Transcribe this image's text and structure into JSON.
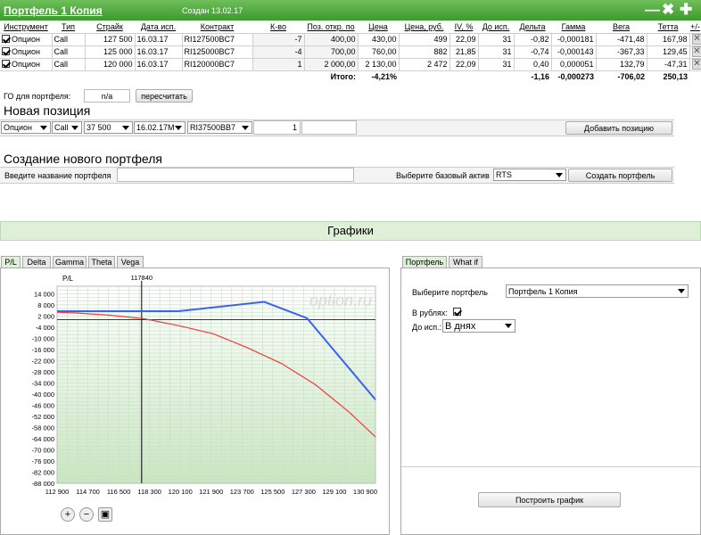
{
  "title": "Портфель 1 Копия",
  "created": "Создан 13.02.17",
  "header_icons": [
    "minimize-icon",
    "close-icon",
    "add-icon"
  ],
  "table": {
    "columns": [
      "Инструмент",
      "Тип",
      "Страйк",
      "Дата исп.",
      "Контракт",
      "К-во",
      "Поз. откр. по",
      "Цена",
      "Цена, руб.",
      "IV, %",
      "До исп.",
      "Дельта",
      "Гамма",
      "Вега",
      "Тетта",
      "+/-"
    ],
    "rows": [
      [
        "Опцион",
        "Call",
        "127 500",
        "16.03.17",
        "RI127500BC7",
        "-7",
        "400,00",
        "430,00",
        "499",
        "22,09",
        "31",
        "-0,82",
        "-0,000181",
        "-471,48",
        "167,98"
      ],
      [
        "Опцион",
        "Call",
        "125 000",
        "16.03.17",
        "RI125000BC7",
        "-4",
        "700,00",
        "760,00",
        "882",
        "21,85",
        "31",
        "-0,74",
        "-0,000143",
        "-367,33",
        "129,45"
      ],
      [
        "Опцион",
        "Call",
        "120 000",
        "16.03.17",
        "RI120000BC7",
        "1",
        "2 000,00",
        "2 130,00",
        "2 472",
        "22,09",
        "31",
        "0,40",
        "0,000051",
        "132,79",
        "-47,31"
      ]
    ],
    "total_label": "Итого:",
    "total_pct": "-4,21%",
    "totals": [
      "-1,16",
      "-0,000273",
      "-706,02",
      "250,13"
    ]
  },
  "go": {
    "label": "ГО для портфеля:",
    "value": "n/a",
    "recalc": "пересчитать"
  },
  "new_position": {
    "heading": "Новая позиция",
    "instrument": "Опцион",
    "type": "Call",
    "strike": "37 500",
    "date": "16.02.17М",
    "contract": "RI37500BB7",
    "qty": "1",
    "add_button": "Добавить позицию"
  },
  "new_portfolio": {
    "heading": "Создание нового портфеля",
    "name_placeholder": "Введите название портфеля",
    "asset_label": "Выберите базовый актив",
    "asset": "RTS",
    "create_button": "Создать портфель"
  },
  "charts_heading": "Графики",
  "chart_tabs": [
    "P/L",
    "Delta",
    "Gamma",
    "Theta",
    "Vega"
  ],
  "right_tabs": [
    "Портфель",
    "What if"
  ],
  "right": {
    "portfolio_label": "Выберите портфель",
    "portfolio": "Портфель 1 Копия",
    "rubles_label": "В рублях:",
    "expiry_label": "До исп.:",
    "expiry": "В днях",
    "build_button": "Построить график"
  },
  "colors": {
    "accent": "#4a9e3a",
    "blue": "#3b63f0",
    "red": "#f03c3c"
  },
  "chart_data": {
    "type": "line",
    "ylabel": "P/L",
    "watermark": "option.ru",
    "marker_label": "117840",
    "marker_x": 117840,
    "xlim": [
      112900,
      131500
    ],
    "ylim": [
      -88000,
      18000
    ],
    "xticks": [
      112900,
      114700,
      116500,
      118300,
      120100,
      121900,
      123700,
      125500,
      127300,
      129100,
      130900
    ],
    "yticks": [
      14000,
      8000,
      2000,
      -4000,
      -10000,
      -16000,
      -22000,
      -28000,
      -34000,
      -40000,
      -46000,
      -52000,
      -58000,
      -64000,
      -70000,
      -76000,
      -82000,
      -88000
    ],
    "series": [
      {
        "color": "#3b63f0",
        "x": [
          112900,
          120000,
          125000,
          127500,
          131500
        ],
        "y": [
          4600,
          4600,
          9600,
          800,
          -43000
        ]
      },
      {
        "color": "#f03c3c",
        "x": [
          112900,
          114000,
          116000,
          118000,
          120000,
          122000,
          124000,
          126000,
          128000,
          130000,
          131500
        ],
        "y": [
          4000,
          3600,
          2400,
          500,
          -3200,
          -7500,
          -15000,
          -23500,
          -35000,
          -50000,
          -63000
        ]
      }
    ]
  }
}
